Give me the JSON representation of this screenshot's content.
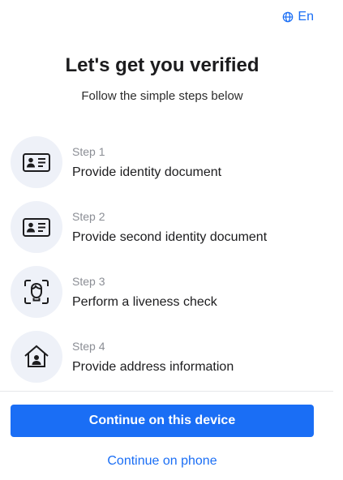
{
  "language": {
    "label": "En",
    "icon": "globe-icon",
    "color": "#1a6ef5"
  },
  "header": {
    "title": "Let's get you verified",
    "subtitle": "Follow the simple steps below"
  },
  "steps": [
    {
      "step": "Step 1",
      "title": "Provide identity document",
      "icon": "id-card-icon"
    },
    {
      "step": "Step 2",
      "title": "Provide second identity document",
      "icon": "id-card-icon"
    },
    {
      "step": "Step 3",
      "title": "Perform a liveness check",
      "icon": "face-scan-icon"
    },
    {
      "step": "Step 4",
      "title": "Provide address information",
      "icon": "home-user-icon"
    }
  ],
  "actions": {
    "primary_label": "Continue on this device",
    "secondary_label": "Continue on phone",
    "accent_color": "#1a6ef5"
  }
}
